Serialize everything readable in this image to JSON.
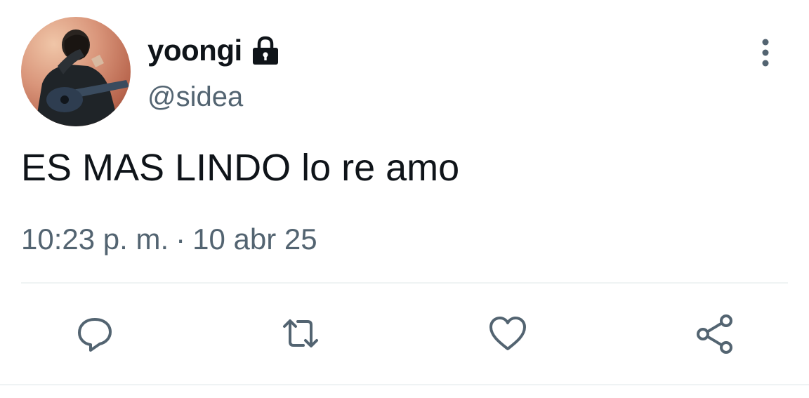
{
  "author": {
    "display_name": "yoongi",
    "handle": "@sidea",
    "protected_icon": "lock-icon",
    "avatar_icon": "user-avatar"
  },
  "tweet": {
    "text": "ES MAS LINDO lo re amo",
    "time": "10:23 p. m.",
    "separator": "·",
    "date": "10 abr 25"
  },
  "menu": {
    "icon": "more-vertical-icon"
  },
  "actions": [
    {
      "name": "reply",
      "icon": "reply-icon"
    },
    {
      "name": "retweet",
      "icon": "retweet-icon"
    },
    {
      "name": "like",
      "icon": "heart-icon"
    },
    {
      "name": "share",
      "icon": "share-icon"
    }
  ],
  "colors": {
    "text_primary": "#0f1419",
    "text_secondary": "#536471",
    "icon": "#536471",
    "divider": "#eff3f4"
  }
}
